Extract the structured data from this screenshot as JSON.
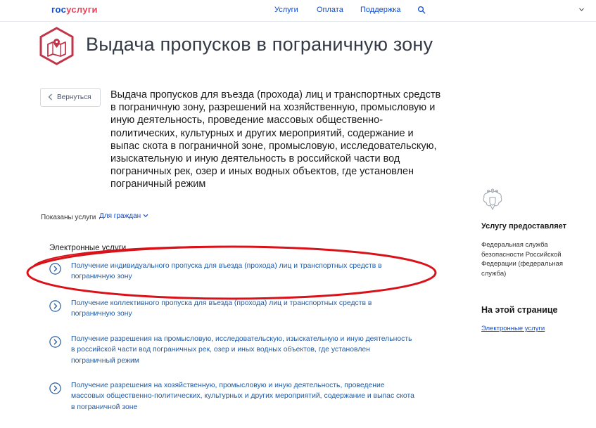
{
  "header": {
    "logo_part1": "гос",
    "logo_part2": "услуги",
    "nav": [
      "Услуги",
      "Оплата",
      "Поддержка"
    ],
    "search_icon": "search-icon",
    "menu_icon": "chevron-down-icon"
  },
  "page": {
    "title": "Выдача пропусков в пограничную зону",
    "icon": "map-pin-icon",
    "back_label": "Вернуться",
    "description": "Выдача пропусков для въезда (прохода) лиц и транспортных средств в пограничную зону, разрешений на хозяйственную, промысловую и иную деятельность, проведение массовых общественно-политических, культурных и других мероприятий, содержание и выпас скота в пограничной зоне, промысловую, исследовательскую, изыскательную и иную деятельность в российской части вод пограничных рек, озер и иных водных объектов, где установлен пограничный режим"
  },
  "filter": {
    "label": "Показаны услуги",
    "value": "Для граждан"
  },
  "services": {
    "section_title": "Электронные услуги",
    "items": [
      "Получение индивидуального пропуска для въезда (прохода) лиц и транспортных средств в пограничную зону",
      "Получение коллективного пропуска для въезда (прохода) лиц и транспортных средств в пограничную зону",
      "Получение разрешения на промысловую, исследовательскую, изыскательную и иную деятельность в российской части вод пограничных рек, озер и иных водных объектов, где установлен пограничный режим",
      "Получение разрешения на хозяйственную, промысловую и иную деятельность, проведение массовых общественно-политических, культурных и других мероприятий, содержание и выпас скота в пограничной зоне"
    ]
  },
  "sidebar": {
    "provider_title": "Услугу предоставляет",
    "provider_name": "Федеральная служба безопасности Российской Федерации (федеральная служба)",
    "on_page_title": "На этой странице",
    "on_page_link": "Электронные услуги"
  },
  "colors": {
    "brand_blue": "#0d4cd3",
    "brand_red": "#ee3f58",
    "link": "#1f5ca8",
    "icon_accent": "#c2344a",
    "annotation_oval": "#d9121a"
  }
}
